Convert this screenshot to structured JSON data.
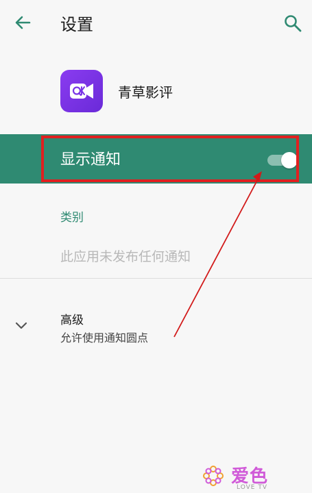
{
  "header": {
    "title": "设置"
  },
  "app": {
    "name": "青草影评"
  },
  "notification": {
    "label": "显示通知",
    "enabled": true
  },
  "category": {
    "title": "类别",
    "empty_message": "此应用未发布任何通知"
  },
  "advanced": {
    "title": "高级",
    "subtitle": "允许使用通知圆点"
  },
  "watermark": {
    "text": "爱色",
    "subtext": "LOVE TV"
  },
  "colors": {
    "accent": "#2f8a72",
    "highlight_border": "#e02020",
    "app_icon": "#7a33e6"
  },
  "icons": {
    "back": "arrow-left-icon",
    "search": "search-icon",
    "expand": "chevron-down-icon"
  }
}
